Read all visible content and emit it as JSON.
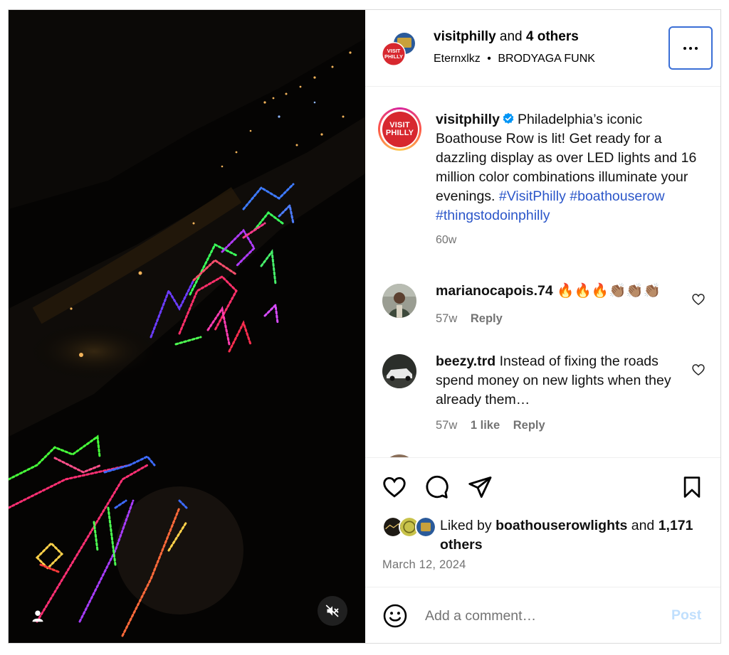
{
  "post": {
    "header": {
      "owner_username": "visitphilly",
      "owner_joiner": "and",
      "owner_collaborators": "4 others",
      "audio_artist": "Eternxlkz",
      "audio_separator": "•",
      "audio_track": "BRODYAGA FUNK",
      "more_icon": "more-horizontal-icon"
    },
    "media": {
      "user_tag_icon": "person-icon",
      "mute_icon": "speaker-muted-icon"
    },
    "caption": {
      "username": "visitphilly",
      "verified_icon": "verified-badge-icon",
      "text": "Philadelphia’s iconic Boathouse Row is lit! Get ready for a dazzling display as over LED lights and 16 million color combinations illuminate your evenings.",
      "hashtags": [
        "#VisitPhilly",
        "#boathouserow",
        "#thingstodoinphilly"
      ],
      "age": "60w",
      "avatar_logo_line1": "VISIT",
      "avatar_logo_line2": "PHILLY"
    },
    "comments": [
      {
        "username": "marianocapois.74",
        "text": "🔥🔥🔥👏🏽👏🏽👏🏽",
        "age": "57w",
        "likes": "",
        "reply_label": "Reply"
      },
      {
        "username": "beezy.trd",
        "text": "Instead of fixing the roads spend money on new lights when they already them…",
        "age": "57w",
        "likes": "1 like",
        "reply_label": "Reply"
      }
    ],
    "actions": {
      "like_icon": "heart-icon",
      "comment_icon": "comment-bubble-icon",
      "share_icon": "paper-plane-icon",
      "save_icon": "bookmark-icon"
    },
    "likes": {
      "prefix": "Liked by",
      "first_liker": "boathouserowlights",
      "joiner": "and",
      "others": "1,171 others"
    },
    "date": "March 12, 2024",
    "add_comment": {
      "placeholder": "Add a comment…",
      "post_label": "Post",
      "emoji_icon": "smiley-face-icon"
    },
    "colors": {
      "link_blue": "#2b56c9",
      "verified_blue": "#0095f6",
      "post_disabled": "#c0dffd",
      "brand_red": "#d7282f",
      "focus_ring": "#3b6fd6"
    }
  }
}
